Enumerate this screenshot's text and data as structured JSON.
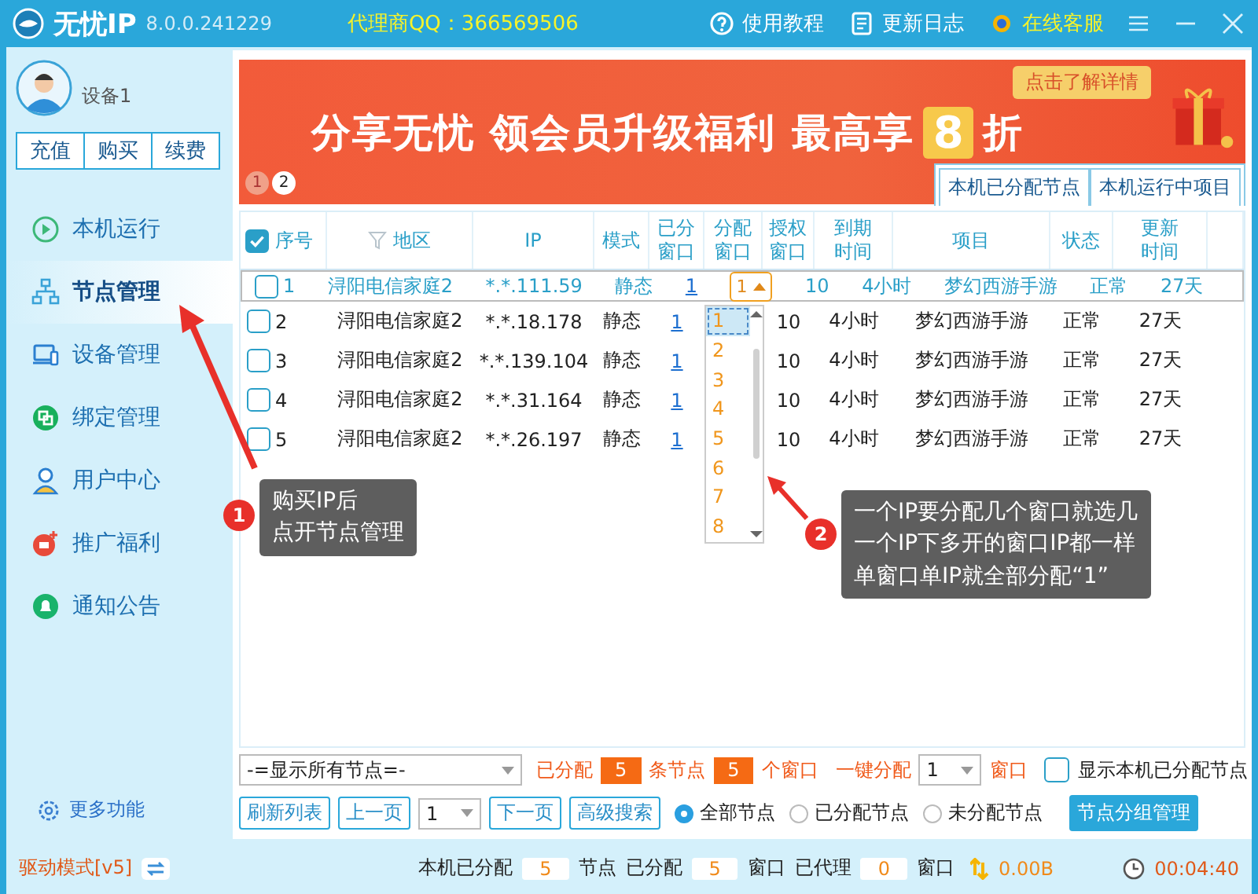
{
  "window": {
    "logo": "无忧IP",
    "version": "8.0.0.241229",
    "agent": "代理商QQ：366569506",
    "links": [
      {
        "label": "使用教程"
      },
      {
        "label": "更新日志"
      },
      {
        "label": "在线客服"
      }
    ]
  },
  "user": {
    "name": "设备1",
    "buttons": [
      "充值",
      "购买",
      "续费"
    ]
  },
  "sidebar": {
    "items": [
      {
        "label": "本机运行",
        "selected": false
      },
      {
        "label": "节点管理",
        "selected": true
      },
      {
        "label": "设备管理",
        "selected": false
      },
      {
        "label": "绑定管理",
        "selected": false
      },
      {
        "label": "用户中心",
        "selected": false
      },
      {
        "label": "推广福利",
        "selected": false
      },
      {
        "label": "通知公告",
        "selected": false
      }
    ],
    "more": "更多功能"
  },
  "banner": {
    "headline": "分享无忧 领会员升级福利 最高享",
    "digit": "8",
    "suffix": "折",
    "cta": "点击了解详情",
    "pages": [
      {
        "label": "1",
        "selected": false
      },
      {
        "label": "2",
        "selected": true
      }
    ]
  },
  "tabs": [
    "本机已分配节点",
    "本机运行中项目"
  ],
  "table": {
    "all_checked": true,
    "columns": [
      "序号",
      "地区",
      "IP",
      "模式",
      "已分窗口",
      "分配窗口",
      "授权窗口",
      "到期时间",
      "项目",
      "状态",
      "更新时间"
    ],
    "rows": [
      {
        "no": "1",
        "checked": false,
        "selected": true,
        "region": "浔阳电信家庭2",
        "ip": "*.*.111.59",
        "mode": "静态",
        "assigned": "1",
        "alloc": "1",
        "auth": "10",
        "expire": "4小时",
        "project": "梦幻西游手游",
        "status": "正常",
        "updated": "27天"
      },
      {
        "no": "2",
        "checked": false,
        "selected": false,
        "region": "浔阳电信家庭2",
        "ip": "*.*.18.178",
        "mode": "静态",
        "assigned": "1",
        "auth": "10",
        "expire": "4小时",
        "project": "梦幻西游手游",
        "status": "正常",
        "updated": "27天"
      },
      {
        "no": "3",
        "checked": false,
        "selected": false,
        "region": "浔阳电信家庭2",
        "ip": "*.*.139.104",
        "mode": "静态",
        "assigned": "1",
        "auth": "10",
        "expire": "4小时",
        "project": "梦幻西游手游",
        "status": "正常",
        "updated": "27天"
      },
      {
        "no": "4",
        "checked": false,
        "selected": false,
        "region": "浔阳电信家庭2",
        "ip": "*.*.31.164",
        "mode": "静态",
        "assigned": "1",
        "auth": "10",
        "expire": "4小时",
        "project": "梦幻西游手游",
        "status": "正常",
        "updated": "27天"
      },
      {
        "no": "5",
        "checked": false,
        "selected": false,
        "region": "浔阳电信家庭2",
        "ip": "*.*.26.197",
        "mode": "静态",
        "assigned": "1",
        "auth": "10",
        "expire": "4小时",
        "project": "梦幻西游手游",
        "status": "正常",
        "updated": "27天"
      }
    ],
    "dropdown": [
      {
        "label": "1",
        "selected": true
      },
      {
        "label": "2",
        "selected": false
      },
      {
        "label": "3",
        "selected": false
      },
      {
        "label": "4",
        "selected": false
      },
      {
        "label": "5",
        "selected": false
      },
      {
        "label": "6",
        "selected": false
      },
      {
        "label": "7",
        "selected": false
      },
      {
        "label": "8",
        "selected": false
      }
    ]
  },
  "annotations": [
    {
      "number": "1",
      "lines": [
        "购买IP后",
        "点开节点管理"
      ]
    },
    {
      "number": "2",
      "lines": [
        "一个IP要分配几个窗口就选几",
        "一个IP下多开的窗口IP都一样",
        "单窗口单IP就全部分配“1”"
      ]
    }
  ],
  "controls": {
    "filter": "-=显示所有节点=-",
    "assigned_label": "已分配",
    "node_count": "5",
    "node_unit": "条节点",
    "window_count": "5",
    "window_unit": "个窗口",
    "one_click": "一键分配",
    "one_click_value": "1",
    "one_click_unit": "窗口",
    "show_local": {
      "label": "显示本机已分配节点",
      "checked": false
    },
    "buttons": [
      "刷新列表",
      "上一页"
    ],
    "page": "1",
    "buttons2": [
      "下一页",
      "高级搜索"
    ],
    "radios": [
      {
        "label": "全部节点",
        "selected": true
      },
      {
        "label": "已分配节点",
        "selected": false
      },
      {
        "label": "未分配节点",
        "selected": false
      }
    ],
    "group_button": "节点分组管理"
  },
  "status_bar": {
    "mode": "驱动模式[v5]",
    "items": [
      {
        "label": "本机已分配",
        "value": "5",
        "unit": "节点"
      },
      {
        "label": "已分配",
        "value": "5",
        "unit": "窗口"
      },
      {
        "label": "已代理",
        "value": "0",
        "unit": "窗口"
      }
    ],
    "speed": "0.00B",
    "time": "00:04:40"
  }
}
